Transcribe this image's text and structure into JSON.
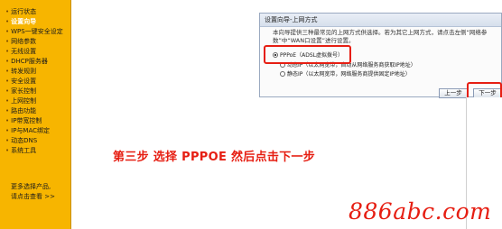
{
  "sidebar": {
    "items": [
      {
        "label": "运行状态",
        "active": false
      },
      {
        "label": "设置向导",
        "active": true
      },
      {
        "label": "WPS一键安全设定",
        "active": false
      },
      {
        "label": "网络参数",
        "active": false
      },
      {
        "label": "无线设置",
        "active": false
      },
      {
        "label": "DHCP服务器",
        "active": false
      },
      {
        "label": "转发规则",
        "active": false
      },
      {
        "label": "安全设置",
        "active": false
      },
      {
        "label": "家长控制",
        "active": false
      },
      {
        "label": "上网控制",
        "active": false
      },
      {
        "label": "路由功能",
        "active": false
      },
      {
        "label": "IP带宽控制",
        "active": false
      },
      {
        "label": "IP与MAC绑定",
        "active": false
      },
      {
        "label": "动态DNS",
        "active": false
      },
      {
        "label": "系统工具",
        "active": false
      }
    ],
    "more_line1": "更多选择产品,",
    "more_line2": "请点击查看 >>"
  },
  "dialog": {
    "title": "设置向导-上网方式",
    "description": "本向导提供三种最常见的上网方式供选择。若为其它上网方式，请点击左侧“网络参数”中“WAN口设置”进行设置。",
    "options": [
      {
        "label": "PPPoE（ADSL虚拟拨号）",
        "checked": true
      },
      {
        "label": "动态IP（以太网宽带，自动从网络服务商获取IP地址）",
        "checked": false
      },
      {
        "label": "静态IP（以太网宽带，网络服务商提供固定IP地址）",
        "checked": false
      }
    ],
    "prev_button": "上一步",
    "next_button": "下一步"
  },
  "annotation": {
    "step_text": "第三步   选择 PPPOE 然后点击下一步",
    "highlight_color": "#e61e12"
  },
  "watermark": "886abc.com",
  "colors": {
    "sidebar_bg": "#f7b500",
    "accent_red": "#e61e12"
  }
}
